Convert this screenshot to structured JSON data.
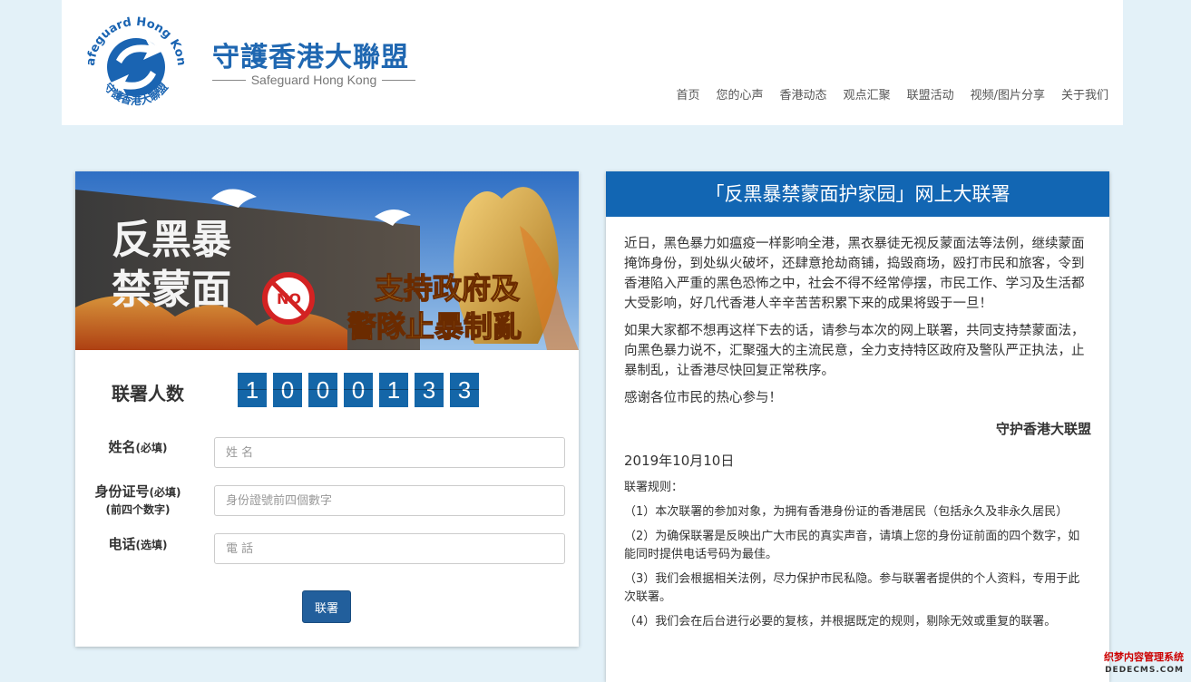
{
  "header": {
    "logo_text_top": "Safeguard Hong Kong",
    "logo_text_bottom": "守護香港大聯盟",
    "title": "守護香港大聯盟",
    "subtitle": "Safeguard Hong Kong",
    "nav": [
      "首页",
      "您的心声",
      "香港动态",
      "观点汇聚",
      "联盟活动",
      "视频/图片分享",
      "关于我们"
    ]
  },
  "banner": {
    "text_left_1": "反黑暴",
    "text_left_2": "禁蒙面",
    "text_right_1": "支持政府及",
    "text_right_2": "警隊止暴制亂",
    "badge_text": "NO"
  },
  "counter": {
    "label": "联署人数",
    "digits": [
      "1",
      "0",
      "0",
      "0",
      "1",
      "3",
      "3"
    ]
  },
  "form": {
    "name_label": "姓名",
    "name_note": "(必填)",
    "name_placeholder": "姓 名",
    "id_label": "身份证号",
    "id_note": "(必填)",
    "id_note2": "(前四个数字)",
    "id_placeholder": "身份證號前四個數字",
    "phone_label": "电话",
    "phone_note": "(选填)",
    "phone_placeholder": "電 話",
    "submit_label": "联署"
  },
  "petition": {
    "title": "「反黑暴禁蒙面护家园」网上大联署",
    "para1": "近日，黑色暴力如瘟疫一样影响全港，黑衣暴徒无视反蒙面法等法例，继续蒙面掩饰身份，到处纵火破坏，还肆意抢劫商铺，捣毁商场，殴打市民和旅客，令到香港陷入严重的黑色恐怖之中，社会不得不经常停摆，市民工作、学习及生活都大受影响，好几代香港人辛辛苦苦积累下来的成果将毁于一旦！",
    "para2": "如果大家都不想再这样下去的话，请参与本次的网上联署，共同支持禁蒙面法，向黑色暴力说不，汇聚强大的主流民意，全力支持特区政府及警队严正执法，止暴制乱，让香港尽快回复正常秩序。",
    "para3": "感谢各位市民的热心参与！",
    "signature": "守护香港大联盟",
    "date": "2019年10月10日",
    "rules_title": "联署规则：",
    "rules": [
      "（1）本次联署的参加对象，为拥有香港身份证的香港居民（包括永久及非永久居民）",
      "（2）为确保联署是反映出广大市民的真实声音，请填上您的身份证前面的四个数字，如能同时提供电话号码为最佳。",
      "（3）我们会根据相关法例，尽力保护市民私隐。参与联署者提供的个人资料，专用于此次联署。",
      "（4）我们会在后台进行必要的复核，并根据既定的规则，剔除无效或重复的联署。"
    ]
  },
  "watermark": {
    "line1": "织梦内容管理系统",
    "line2": "DEDECMS.COM"
  },
  "colors": {
    "accent": "#1266b3",
    "title_blue": "#1f67b1",
    "page_bg": "#e3f1f8",
    "digit_bg": "#1466a8",
    "button_bg": "#225f9c"
  }
}
